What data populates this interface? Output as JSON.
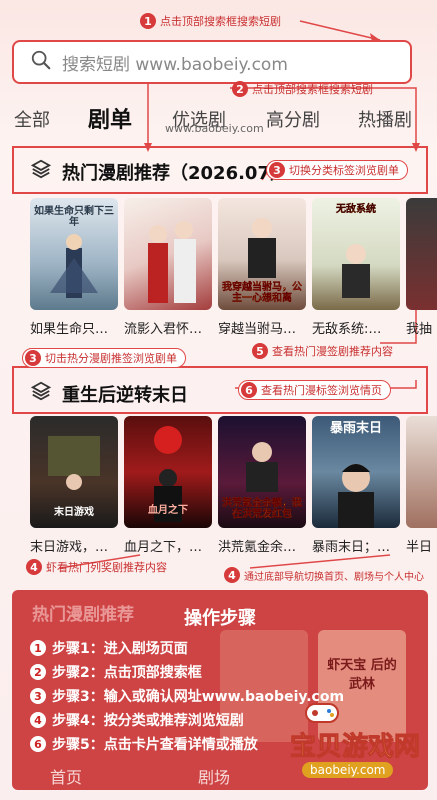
{
  "search": {
    "placeholder": "搜索短剧 www.baobeiy.com"
  },
  "tabs": [
    "全部",
    "剧单",
    "优选剧",
    "高分剧",
    "热播剧"
  ],
  "tab_watermark": "www.baobeiy.com",
  "section1": {
    "title": "热门漫剧推荐（2026.07）",
    "cards": [
      {
        "title": "如果生命只…",
        "poster_text": "如果生命只剩下三年"
      },
      {
        "title": "流影入君怀…",
        "poster_text": ""
      },
      {
        "title": "穿越当驸马…",
        "poster_text": "我穿越当驸马，公主一心想和离"
      },
      {
        "title": "无敌系统:…",
        "poster_text": "无敌系统"
      },
      {
        "title": "我抽",
        "poster_text": ""
      }
    ]
  },
  "section2": {
    "title": "重生后逆转末日",
    "cards": [
      {
        "title": "末日游戏，…",
        "poster_text": "末日游戏"
      },
      {
        "title": "血月之下，…",
        "poster_text": "血月之下"
      },
      {
        "title": "洪荒氪金余…",
        "poster_text": "洪荒氪金余额，我在洪荒发红包"
      },
      {
        "title": "暴雨末日；…",
        "poster_text": "暴雨末日"
      },
      {
        "title": "半日",
        "poster_text": ""
      }
    ]
  },
  "annotations": {
    "a1": {
      "num": "1",
      "text": "点击顶部搜索框搜索短剧"
    },
    "a2": {
      "num": "2",
      "text": "点击顶部搜索框搜索短剧"
    },
    "a3": {
      "num": "3",
      "text": "切换分类标签浏览剧单"
    },
    "a4": {
      "num": "3",
      "text": "切击热分漫剧推签浏览剧单"
    },
    "a5": {
      "num": "5",
      "text": "查看热门漫签剧推荐内容"
    },
    "a6": {
      "num": "6",
      "text": "查看热门漫标签浏览情页"
    },
    "a7": {
      "num": "4",
      "text": "虾看热门列奖剧推荐内容"
    },
    "a8": {
      "num": "4",
      "text": "通过底部导航切换首页、剧场与个人中心"
    }
  },
  "steps": {
    "title": "操作步骤",
    "list": [
      {
        "num": "1",
        "text": "步骤1：进入剧场页面"
      },
      {
        "num": "2",
        "text": "步骤2：点击顶部搜索框"
      },
      {
        "num": "3",
        "text": "步骤3：输入或确认网址www.baobeiy.com"
      },
      {
        "num": "4",
        "text": "步骤4：按分类或推荐浏览短剧"
      },
      {
        "num": "6",
        "text": "步骤5：点击卡片查看详情或播放"
      }
    ],
    "behind_header": "热门漫剧推荐",
    "behind_poster_text": "虾天宝 后的武林"
  },
  "bottom_nav": [
    "首页",
    "剧场"
  ],
  "logo": {
    "brand": "宝贝游戏网",
    "url": "baobeiy.com"
  },
  "colors": {
    "accent": "#e04848",
    "overlay": "#c62828"
  }
}
